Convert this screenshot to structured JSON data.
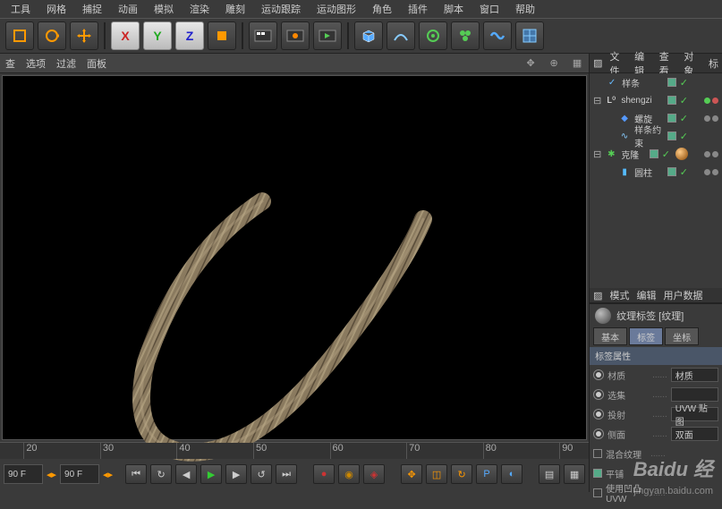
{
  "menu": {
    "items": [
      "工具",
      "网格",
      "捕捉",
      "动画",
      "模拟",
      "渲染",
      "雕刻",
      "运动跟踪",
      "运动图形",
      "角色",
      "插件",
      "脚本",
      "窗口",
      "帮助"
    ]
  },
  "vp_header": {
    "items": [
      "查",
      "选项",
      "过滤",
      "面板"
    ]
  },
  "right_tabs": {
    "items": [
      "文件",
      "编辑",
      "查看",
      "对象",
      "标"
    ]
  },
  "tree": {
    "items": [
      {
        "name": "样条",
        "icon": "✓",
        "color": "#6bf",
        "depth": 0,
        "checked": true
      },
      {
        "name": "shengzi",
        "icon": "L⁰",
        "color": "#fff",
        "depth": 0,
        "prefix": "⊟",
        "checked": true,
        "dots": [
          "g",
          "r"
        ]
      },
      {
        "name": "螺旋",
        "icon": "◆",
        "color": "#59f",
        "depth": 1,
        "checked": true,
        "dots": [
          "gy",
          "gy"
        ]
      },
      {
        "name": "样条约束",
        "icon": "∿",
        "color": "#8cf",
        "depth": 1,
        "checked": true
      },
      {
        "name": "克隆",
        "icon": "✱",
        "color": "#5c5",
        "depth": 0,
        "prefix": "⊟",
        "checked": true,
        "dots": [
          "gy",
          "gy"
        ],
        "tag": "sphere"
      },
      {
        "name": "圆柱",
        "icon": "▮",
        "color": "#5bf",
        "depth": 1,
        "checked": true,
        "dots": [
          "gy",
          "gy"
        ]
      }
    ]
  },
  "attr_tabs": {
    "items": [
      "模式",
      "编辑",
      "用户数据"
    ]
  },
  "attr_title": "纹理标签 [纹理]",
  "sub_tabs": {
    "items": [
      "基本",
      "标签",
      "坐标"
    ],
    "active": 1
  },
  "section": "标签属性",
  "props": [
    {
      "label": "材质",
      "value": "材质",
      "radio": true
    },
    {
      "label": "选集",
      "value": "",
      "radio": true
    },
    {
      "label": "投射",
      "value": "UVW 贴图",
      "radio": true
    },
    {
      "label": "侧面",
      "value": "双面",
      "radio": true
    },
    {
      "label": "混合纹理",
      "value": "",
      "checkbox": true
    },
    {
      "label": "平铺",
      "value": "",
      "checkbox": true,
      "checked": true
    },
    {
      "label": "使用凹凸 UVW",
      "value": "",
      "checkbox": true
    }
  ],
  "timeline": {
    "ticks": [
      20,
      30,
      40,
      50,
      60,
      70,
      80,
      90
    ],
    "frame_start": "90 F",
    "frame_current": "90 F"
  },
  "watermark": "Baidu 经",
  "watermark_sub": "jingyan.baidu.com"
}
